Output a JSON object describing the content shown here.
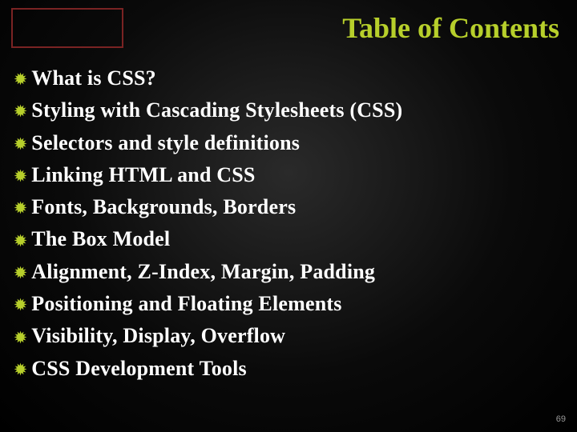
{
  "title": "Table of Contents",
  "items": [
    "What is CSS?",
    "Styling with Cascading Stylesheets (CSS)",
    "Selectors and style definitions",
    "Linking HTML and CSS",
    "Fonts, Backgrounds, Borders",
    "The Box Model",
    "Alignment, Z-Index, Margin, Padding",
    "Positioning and Floating Elements",
    "Visibility, Display, Overflow",
    "CSS Development Tools"
  ],
  "page_number": "69"
}
